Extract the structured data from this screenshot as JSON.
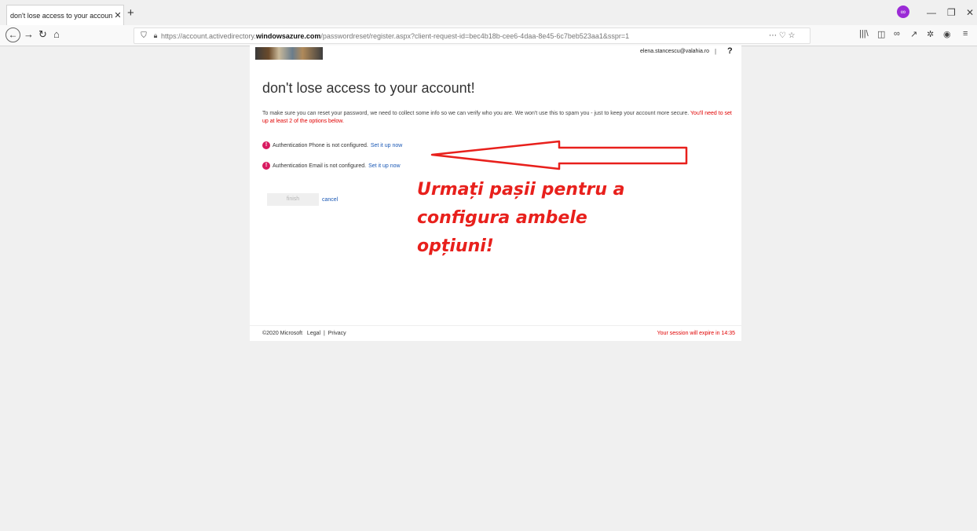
{
  "browser": {
    "tab_title": "don't lose access to your account!",
    "tab_close": "✕",
    "new_tab": "+",
    "minimize": "—",
    "restore": "❐",
    "close": "✕",
    "url_plain_prefix": "https://account.activedirectory.",
    "url_domain": "windowsazure.com",
    "url_path": "/passwordreset/register.aspx?client-request-id=bec4b18b-cee6-4daa-8e45-6c7beb523aa1&sspr=1",
    "url_actions": "⋯ ♡ ☆",
    "profile_badge": "∞",
    "toolbar_icons": [
      "|||\\",
      "◫",
      "∞",
      "↗",
      "✲",
      "◉",
      "≡"
    ]
  },
  "header": {
    "user_email": "elena.stancescu@valahia.ro",
    "separator": "|",
    "help": "?"
  },
  "main": {
    "title": "don't lose access to your account!",
    "intro": "To make sure you can reset your password, we need to collect some info so we can verify who you are. We won't use this to spam you - just to keep your account more secure.",
    "requirement": "You'll need to set up at least 2 of the options below.",
    "options": [
      {
        "label": "Authentication Phone is not configured.",
        "link": "Set it up now"
      },
      {
        "label": "Authentication Email is not configured.",
        "link": "Set it up now"
      }
    ],
    "finish_label": "finish",
    "cancel_label": "cancel"
  },
  "annotation": {
    "line1": "Urmați pașii pentru a",
    "line2": "configura ambele",
    "line3": "opțiuni!",
    "color": "#e8201c"
  },
  "footer": {
    "copyright": "©2020 Microsoft",
    "legal": "Legal",
    "separator": "|",
    "privacy": "Privacy",
    "session": "Your session will expire in 14:35"
  }
}
